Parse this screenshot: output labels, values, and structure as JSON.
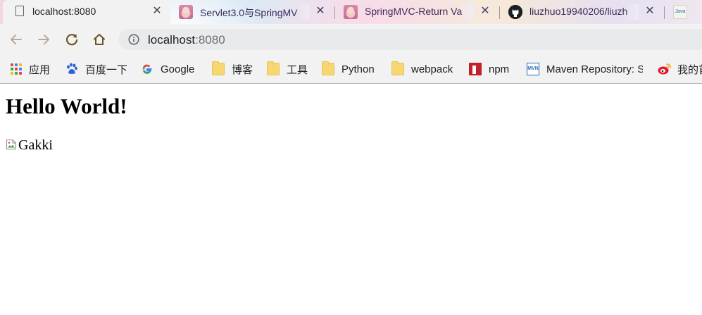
{
  "browser": {
    "tabs": [
      {
        "title": "localhost:8080",
        "favicon": "document-icon",
        "active": true
      },
      {
        "title": "Servlet3.0与SpringMV",
        "favicon": "anime-avatar-icon",
        "active": false
      },
      {
        "title": "SpringMVC-Return Va",
        "favicon": "anime-avatar-icon",
        "active": false
      },
      {
        "title": "liuzhuo19940206/liuzh",
        "favicon": "github-icon",
        "active": false
      },
      {
        "title": "",
        "favicon": "java-icon",
        "active": false
      }
    ],
    "java_favicon_text": "Java",
    "toolbar": {
      "back_icon": "arrow-left-icon",
      "forward_icon": "arrow-right-icon",
      "reload_icon": "reload-icon",
      "home_icon": "home-icon",
      "url_host": "localhost",
      "url_port": ":8080"
    },
    "bookmarks": [
      {
        "label": "应用",
        "icon": "apps-grid-icon"
      },
      {
        "label": "百度一下",
        "icon": "baidu-paw-icon"
      },
      {
        "label": "Google",
        "icon": "google-g-icon"
      },
      {
        "label": "博客",
        "icon": "folder-icon"
      },
      {
        "label": "工具",
        "icon": "folder-icon"
      },
      {
        "label": "Python",
        "icon": "folder-icon"
      },
      {
        "label": "webpack",
        "icon": "folder-icon"
      },
      {
        "label": "npm",
        "icon": "npm-icon"
      },
      {
        "label": "Maven Repository: S",
        "icon": "maven-icon"
      },
      {
        "label": "我的首",
        "icon": "weibo-icon"
      }
    ],
    "mvn_icon_text": "MVN",
    "colors": {
      "tab_active_bg": "#f2f2f2",
      "toolbar_bg": "#f2f2f2",
      "omnibox_bg": "#e9eaec",
      "nav_disabled": "#bba9a0",
      "nav_enabled": "#6d5322"
    }
  },
  "page": {
    "heading": "Hello World!",
    "image_alt": "Gakki"
  }
}
